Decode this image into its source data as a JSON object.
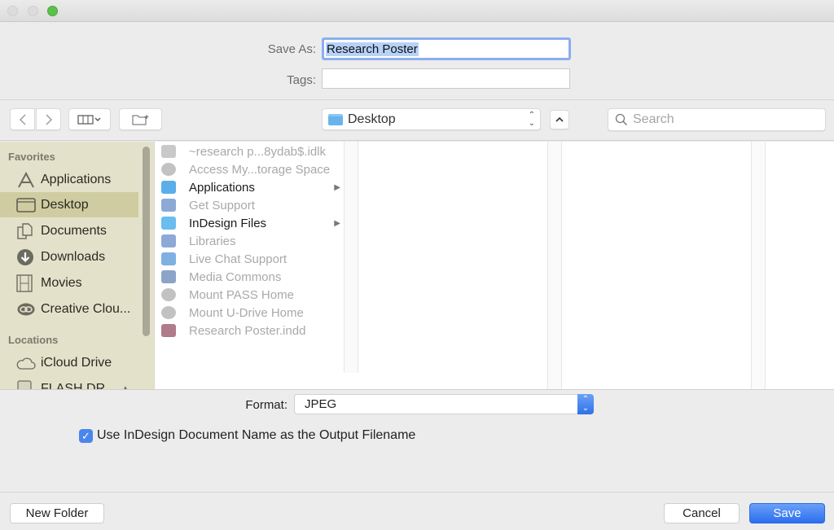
{
  "window": {
    "traffic_lights": [
      "close",
      "minimize",
      "zoom"
    ]
  },
  "header": {
    "save_as_label": "Save As:",
    "save_as_value": "Research Poster",
    "tags_label": "Tags:",
    "tags_value": ""
  },
  "toolbar": {
    "back_icon": "chevron-left",
    "forward_icon": "chevron-right",
    "view_icon": "column-view",
    "new_folder_icon": "folder-plus",
    "location": "Desktop",
    "search_placeholder": "Search"
  },
  "sidebar": {
    "favorites_heading": "Favorites",
    "favorites": [
      {
        "label": "Applications",
        "icon": "applications-icon"
      },
      {
        "label": "Desktop",
        "icon": "desktop-icon",
        "selected": true
      },
      {
        "label": "Documents",
        "icon": "documents-icon"
      },
      {
        "label": "Downloads",
        "icon": "downloads-icon"
      },
      {
        "label": "Movies",
        "icon": "movies-icon"
      },
      {
        "label": "Creative Clou...",
        "icon": "creative-cloud-icon"
      }
    ],
    "locations_heading": "Locations",
    "locations": [
      {
        "label": "iCloud Drive",
        "icon": "cloud-icon"
      },
      {
        "label": "FLASH DR...",
        "icon": "drive-icon"
      }
    ]
  },
  "files": [
    {
      "name": "~research p...8ydab$.idlk",
      "enabled": false,
      "icon": "lock-file-icon",
      "color": "#c9c9c9"
    },
    {
      "name": "Access My...torage Space",
      "enabled": false,
      "icon": "network-alias-icon",
      "color": "#c2c2c2"
    },
    {
      "name": "Applications",
      "enabled": true,
      "icon": "folder-alias-icon",
      "color": "#5aaee9",
      "has_children": true
    },
    {
      "name": "Get Support",
      "enabled": false,
      "icon": "app-icon",
      "color": "#8da9d6"
    },
    {
      "name": "InDesign Files",
      "enabled": true,
      "icon": "folder-icon",
      "color": "#6bbcef",
      "has_children": true
    },
    {
      "name": "Libraries",
      "enabled": false,
      "icon": "app-icon",
      "color": "#8da9d6"
    },
    {
      "name": "Live Chat Support",
      "enabled": false,
      "icon": "app-icon",
      "color": "#7eb1e2"
    },
    {
      "name": "Media Commons",
      "enabled": false,
      "icon": "app-icon",
      "color": "#8da4c9"
    },
    {
      "name": "Mount PASS Home",
      "enabled": false,
      "icon": "network-alias-icon",
      "color": "#c2c2c2"
    },
    {
      "name": "Mount U-Drive Home",
      "enabled": false,
      "icon": "network-alias-icon",
      "color": "#c2c2c2"
    },
    {
      "name": "Research Poster.indd",
      "enabled": false,
      "icon": "indesign-file-icon",
      "color": "#b07b8a"
    }
  ],
  "options": {
    "format_label": "Format:",
    "format_value": "JPEG",
    "use_doc_name_label": "Use InDesign Document Name as the Output Filename",
    "use_doc_name_checked": true
  },
  "footer": {
    "new_folder": "New Folder",
    "cancel": "Cancel",
    "save": "Save"
  },
  "colors": {
    "accent": "#2f71e8",
    "sidebar_bg": "#e4e1cb",
    "sidebar_selected": "#d0cca1"
  }
}
